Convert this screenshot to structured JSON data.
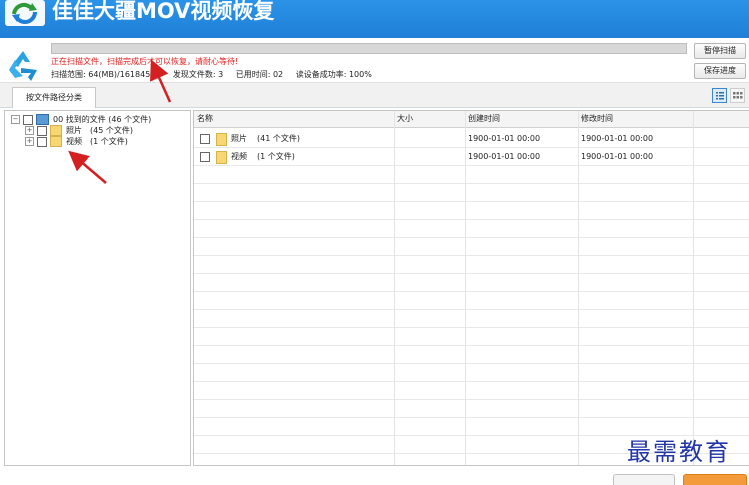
{
  "app": {
    "title": "佳佳大疆MOV视频恢复"
  },
  "scan": {
    "warning": "正在扫描文件，扫描完成后才可以恢复，请耐心等待!",
    "range": "扫描范围: 64(MB)/161845(M",
    "found": "发现文件数: 3",
    "elapsed": "已用时间: 02",
    "success_rate": "读设备成功率: 100%"
  },
  "buttons": {
    "pause": "暂停扫描",
    "save_progress": "保存进度"
  },
  "tabs": {
    "by_path": "按文件路径分类"
  },
  "tree": {
    "root": "00 找到的文件 (46 个文件)",
    "items": [
      {
        "label": "照片",
        "count": "(45 个文件)"
      },
      {
        "label": "视频",
        "count": "(1 个文件)"
      }
    ]
  },
  "table": {
    "columns": [
      "名称",
      "大小",
      "创建时间",
      "修改时间"
    ],
    "rows": [
      {
        "name": "照片",
        "count": "(41 个文件)",
        "size": "",
        "created": "1900-01-01 00:00",
        "modified": "1900-01-01 00:00"
      },
      {
        "name": "视频",
        "count": "(1 个文件)",
        "size": "",
        "created": "1900-01-01 00:00",
        "modified": "1900-01-01 00:00"
      }
    ]
  },
  "watermark": "最需教育",
  "colors": {
    "titlebar": "#1f7fd6",
    "warning": "#e02020",
    "arrow": "#d42020",
    "watermark": "#2236a8",
    "folder": "#f7d774"
  }
}
